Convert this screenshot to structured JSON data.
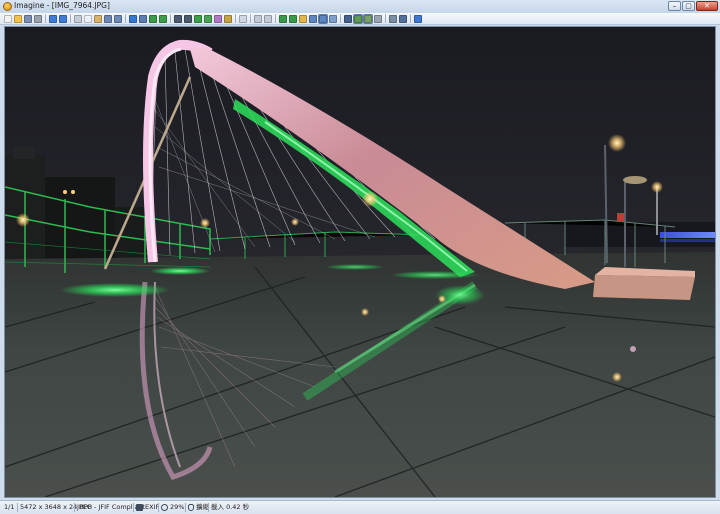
{
  "window": {
    "title": "Imagine - [IMG_7964.JPG]",
    "buttons": {
      "minimize": "–",
      "maximize": "▢",
      "close": "✕"
    }
  },
  "toolbar": {
    "icons": [
      {
        "name": "new-icon",
        "color": "#f3f3f3"
      },
      {
        "name": "open-folder-icon",
        "color": "#f2c24b"
      },
      {
        "name": "save-icon",
        "color": "#7b8fb5"
      },
      {
        "name": "print-icon",
        "color": "#9aa3ad"
      },
      {
        "sep": true
      },
      {
        "name": "previous-icon",
        "color": "#3e7cd8"
      },
      {
        "name": "next-icon",
        "color": "#3e7cd8"
      },
      {
        "sep": true
      },
      {
        "name": "cut-icon",
        "color": "#c7cdd6"
      },
      {
        "name": "copy-icon",
        "color": "#eef2f8"
      },
      {
        "name": "paste-icon",
        "color": "#d9b36a"
      },
      {
        "name": "undo-icon",
        "color": "#6e88b5"
      },
      {
        "name": "redo-icon",
        "color": "#6e88b5"
      },
      {
        "sep": true
      },
      {
        "name": "info-icon",
        "color": "#3478d4"
      },
      {
        "name": "thumbnails-icon",
        "color": "#5b7fb0"
      },
      {
        "name": "fullscreen-icon",
        "color": "#3b9b49"
      },
      {
        "name": "slideshow-icon",
        "color": "#3c9d4a"
      },
      {
        "sep": true
      },
      {
        "name": "rotate-left-icon",
        "color": "#4d5b6e"
      },
      {
        "name": "rotate-right-icon",
        "color": "#4d5b6e"
      },
      {
        "name": "flip-icon",
        "color": "#3ba04a"
      },
      {
        "name": "crop-icon",
        "color": "#4aa355"
      },
      {
        "name": "resize-icon",
        "color": "#b07ac4"
      },
      {
        "name": "adjust-icon",
        "color": "#c5a444"
      },
      {
        "sep": true
      },
      {
        "name": "effects-icon",
        "color": "#d0d8e4"
      },
      {
        "sep": true
      },
      {
        "name": "zoom-in-icon",
        "color": "#c3cbd7"
      },
      {
        "name": "zoom-out-icon",
        "color": "#c3cbd7"
      },
      {
        "sep": true
      },
      {
        "name": "fit-width-icon",
        "color": "#3a9a4a"
      },
      {
        "name": "fit-height-icon",
        "color": "#3a9a4a"
      },
      {
        "name": "fit-window-icon",
        "color": "#e1b74d"
      },
      {
        "name": "actual-size-icon",
        "color": "#5f86c2"
      },
      {
        "name": "zoom-mode-icon",
        "color": "#5f86c2",
        "pressed": true
      },
      {
        "name": "window-fit-icon",
        "color": "#7fa0cc"
      },
      {
        "sep": true
      },
      {
        "name": "view-mode-icon",
        "color": "#44628e"
      },
      {
        "name": "image-view-icon",
        "color": "#5f9a55",
        "pressed": true
      },
      {
        "name": "edit-view-icon",
        "color": "#7a9f6a",
        "pressed": true
      },
      {
        "name": "tools-icon",
        "color": "#9aa5b2"
      },
      {
        "sep": true
      },
      {
        "name": "plugins-icon",
        "color": "#7c8ea6"
      },
      {
        "name": "options-icon",
        "color": "#54709a"
      },
      {
        "sep": true
      },
      {
        "name": "help-icon",
        "color": "#3e78d2"
      }
    ]
  },
  "status": {
    "page": "1/1",
    "dimensions": "5472 x 3648 x 24 BPP",
    "format": "JPEG - JFIF Compliant",
    "exif": "EXIF",
    "zoom": "29%",
    "mode": "擴縮",
    "load_time": "載入 0.42 秒",
    "icons": {
      "exif": "camera-icon",
      "zoom": "magnifier-icon",
      "mode": "mouse-icon"
    }
  },
  "colors": {
    "glow_green": "#2be05a",
    "glow_pink": "#f6c6e6",
    "sky": "#1b1c22",
    "lamp": "#ffcf77"
  }
}
